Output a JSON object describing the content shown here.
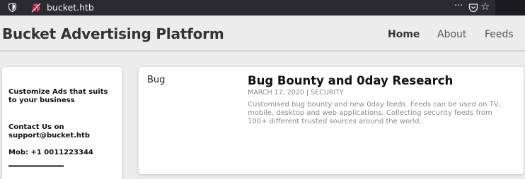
{
  "browser": {
    "url": "bucket.htb",
    "more_label": "···"
  },
  "site": {
    "brand": "Bucket Advertising Platform",
    "nav": {
      "home": "Home",
      "about": "About",
      "feeds": "Feeds"
    }
  },
  "sidebar": {
    "tagline": "Customize Ads that suits to your business",
    "contact": "Contact Us on support@bucket.htb",
    "mobile": "Mob: +1 0011223344"
  },
  "post": {
    "category": "Bug",
    "title": "Bug Bounty and 0day Research",
    "meta": "MARCH 17, 2020 | SECURITY",
    "description": "Customised bug bounty and new 0day feeds. Feeds can be used on TV, mobile, desktop and web applications. Collecting security feeds from 100+ different trusted sources around the world."
  },
  "colors": {
    "browser_bar": "#2b2a33",
    "page_bg": "#ececec",
    "favicon": "#e24a63"
  }
}
